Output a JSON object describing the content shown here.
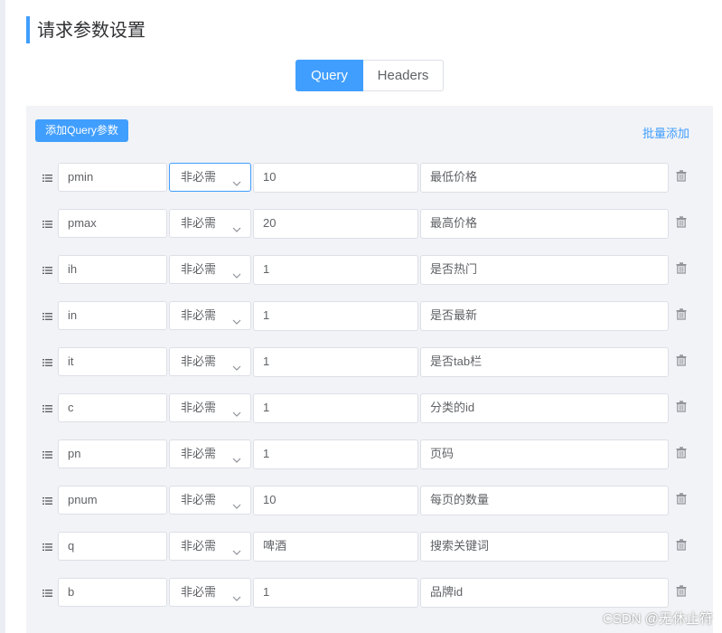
{
  "title": "请求参数设置",
  "tabs": [
    {
      "label": "Query",
      "active": true
    },
    {
      "label": "Headers",
      "active": false
    }
  ],
  "add_button": "添加Query参数",
  "batch_add": "批量添加",
  "params": [
    {
      "name": "pmin",
      "required": "非必需",
      "value": "10",
      "desc": "最低价格"
    },
    {
      "name": "pmax",
      "required": "非必需",
      "value": "20",
      "desc": "最高价格"
    },
    {
      "name": "ih",
      "required": "非必需",
      "value": "1",
      "desc": "是否热门"
    },
    {
      "name": "in",
      "required": "非必需",
      "value": "1",
      "desc": "是否最新"
    },
    {
      "name": "it",
      "required": "非必需",
      "value": "1",
      "desc": "是否tab栏"
    },
    {
      "name": "c",
      "required": "非必需",
      "value": "1",
      "desc": "分类的id"
    },
    {
      "name": "pn",
      "required": "非必需",
      "value": "1",
      "desc": "页码"
    },
    {
      "name": "pnum",
      "required": "非必需",
      "value": "10",
      "desc": "每页的数量"
    },
    {
      "name": "q",
      "required": "非必需",
      "value": "啤酒",
      "desc": "搜索关键词"
    },
    {
      "name": "b",
      "required": "非必需",
      "value": "1",
      "desc": "品牌id"
    }
  ],
  "watermark": "CSDN @无休止符",
  "colors": {
    "accent": "#409eff",
    "panel": "#f2f3f6",
    "border": "#dcdfe6"
  }
}
